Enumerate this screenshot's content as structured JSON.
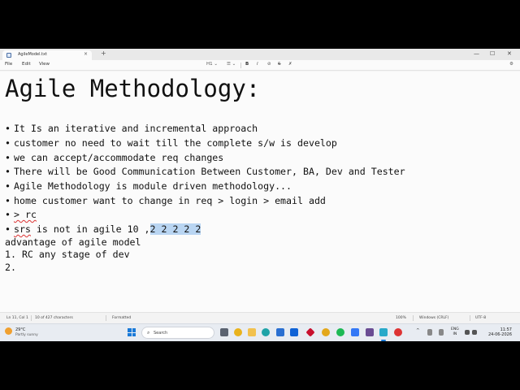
{
  "window": {
    "tab_title": "AgileModel.txt",
    "tab_close": "×",
    "new_tab": "+",
    "minimize": "—",
    "maximize": "☐",
    "close": "✕"
  },
  "menu": {
    "file": "File",
    "edit": "Edit",
    "view": "View"
  },
  "format": {
    "heading": "H1 ⌄",
    "list": "☰ ⌄",
    "bold": "B",
    "italic": "I",
    "strike": "S",
    "link": "⊘",
    "clear": "✗",
    "settings": "⚙"
  },
  "document": {
    "title": "Agile Methodology:",
    "bullet": "•",
    "bullets": [
      "It Is an iterative and incremental approach",
      "customer no need to wait till the complete s/w is develop",
      "we can accept/accommodate req changes",
      "There will be Good Communication Between Customer, BA, Dev and Tester",
      "Agile Methodology is module driven methodology...",
      "home customer want to change in req > login > email add",
      "> rc"
    ],
    "srs_line": {
      "word": "srs",
      "middle": " is not in agile 10 ,",
      "selected": "2 2 2 2 2 "
    },
    "lines": [
      "advantage of agile model",
      "1. RC any stage of dev",
      "2."
    ]
  },
  "status": {
    "position": "Ln 11, Col 1",
    "chars": "10 of 427 characters",
    "format": "Formatted",
    "zoom": "100%",
    "line_ending": "Windows (CRLF)",
    "encoding": "UTF-8"
  },
  "taskbar": {
    "weather_temp": "29°C",
    "weather_desc": "Partly sunny",
    "search_label": "Search",
    "search_glyph": "⌕",
    "tray_chevron": "^",
    "lang_top": "ENG",
    "lang_bottom": "IN",
    "time": "11:57",
    "date": "24-06-2026"
  }
}
